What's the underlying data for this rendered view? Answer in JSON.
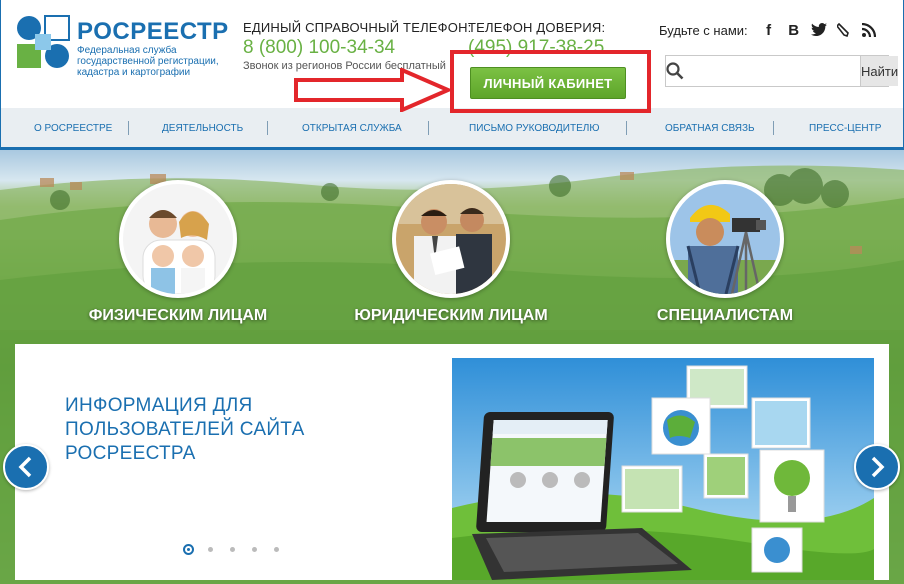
{
  "logo": {
    "title": "РОСРЕЕСТР",
    "subtitle": "Федеральная служба государственной регистрации, кадастра и картографии"
  },
  "hotline": {
    "label": "ЕДИНЫЙ СПРАВОЧНЫЙ ТЕЛЕФОН:",
    "number": "8 (800) 100-34-34",
    "note": "Звонок из регионов России бесплатный"
  },
  "trustline": {
    "label": "ТЕЛЕФОН ДОВЕРИЯ:",
    "number": "(495) 917-38-25"
  },
  "social": {
    "label": "Будьте с нами:",
    "icons": [
      {
        "name": "facebook-icon",
        "glyph": "f"
      },
      {
        "name": "vkontakte-icon",
        "glyph": "B"
      },
      {
        "name": "twitter-icon",
        "glyph": "🐦"
      },
      {
        "name": "livejournal-icon",
        "glyph": "✎"
      },
      {
        "name": "rss-icon",
        "glyph": "ʟ"
      }
    ]
  },
  "search": {
    "placeholder": "",
    "button_label": "Найти"
  },
  "cabinet": {
    "label": "ЛИЧНЫЙ КАБИНЕТ"
  },
  "nav": {
    "items": [
      "О РОСРЕЕСТРЕ",
      "ДЕЯТЕЛЬНОСТЬ",
      "ОТКРЫТАЯ СЛУЖБА",
      "ПИСЬМО РУКОВОДИТЕЛЮ",
      "ОБРАТНАЯ СВЯЗЬ",
      "ПРЕСС-ЦЕНТР"
    ]
  },
  "personas": [
    {
      "label": "ФИЗИЧЕСКИМ ЛИЦАМ"
    },
    {
      "label": "ЮРИДИЧЕСКИМ ЛИЦАМ"
    },
    {
      "label": "СПЕЦИАЛИСТАМ"
    }
  ],
  "slider": {
    "title": "ИНФОРМАЦИЯ ДЛЯ ПОЛЬЗОВАТЕЛЕЙ САЙТА РОСРЕЕСТРА",
    "active_slide": 1,
    "slide_count": 5
  },
  "colors": {
    "brand_blue": "#1a6fb0",
    "accent_green": "#69b144",
    "highlight_red": "#e3262b"
  }
}
